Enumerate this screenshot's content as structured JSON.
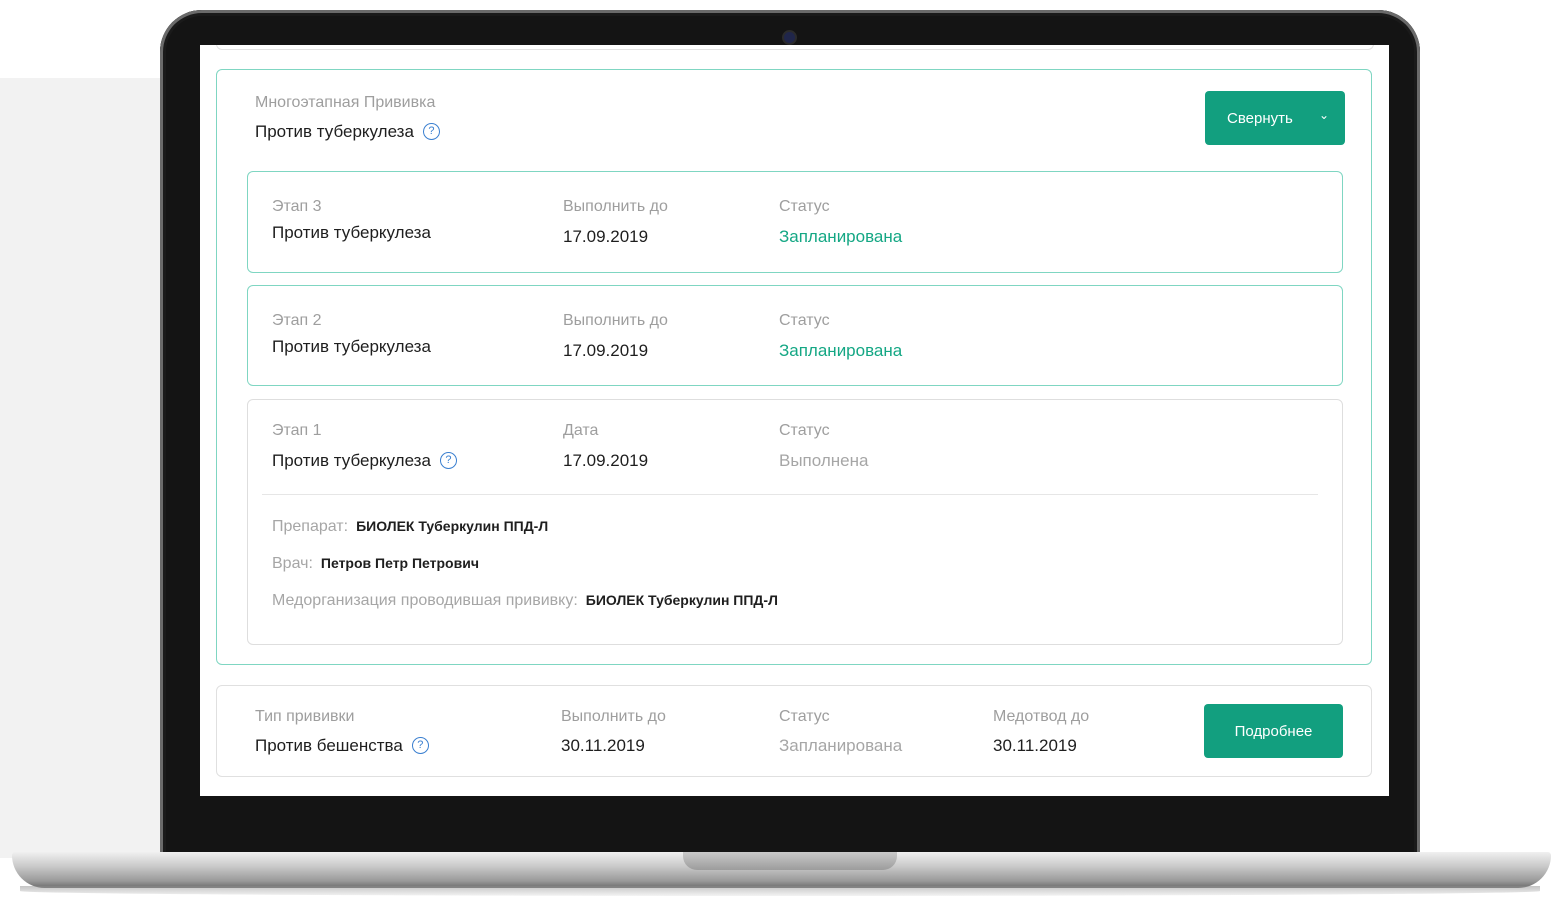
{
  "group": {
    "type_label": "Многоэтапная Прививка",
    "name": "Против туберкулеза",
    "collapse_button": "Свернуть"
  },
  "stages": [
    {
      "stage_label": "Этап 3",
      "name": "Против туберкулеза",
      "date_label": "Выполнить до",
      "date": "17.09.2019",
      "status_label": "Статус",
      "status": "Запланирована"
    },
    {
      "stage_label": "Этап 2",
      "name": "Против туберкулеза",
      "date_label": "Выполнить до",
      "date": "17.09.2019",
      "status_label": "Статус",
      "status": "Запланирована"
    },
    {
      "stage_label": "Этап 1",
      "name": "Против туберкулеза",
      "date_label": "Дата",
      "date": "17.09.2019",
      "status_label": "Статус",
      "status": "Выполнена",
      "details": {
        "drug_label": "Препарат:",
        "drug": "БИОЛЕК Туберкулин ППД-Л",
        "doctor_label": "Врач:",
        "doctor": "Петров Петр Петрович",
        "org_label": "Медорганизация проводившая прививку:",
        "org": "БИОЛЕК Туберкулин ППД-Л"
      }
    }
  ],
  "bottom": {
    "type_label": "Тип прививки",
    "type": "Против бешенства",
    "date_label": "Выполнить до",
    "date": "30.11.2019",
    "status_label": "Статус",
    "status": "Запланирована",
    "exemption_label": "Медотвод до",
    "exemption": "30.11.2019",
    "details_button": "Подробнее"
  },
  "icons": {
    "help": "question-circle-icon",
    "chevron": "chevron-down-icon",
    "help_glyph": "?",
    "chevron_glyph": "⌄"
  },
  "colors": {
    "accent": "#129f7f",
    "planned_status": "#14a784",
    "active_border": "#7fd6c2",
    "help_icon": "#3a7fd0"
  }
}
